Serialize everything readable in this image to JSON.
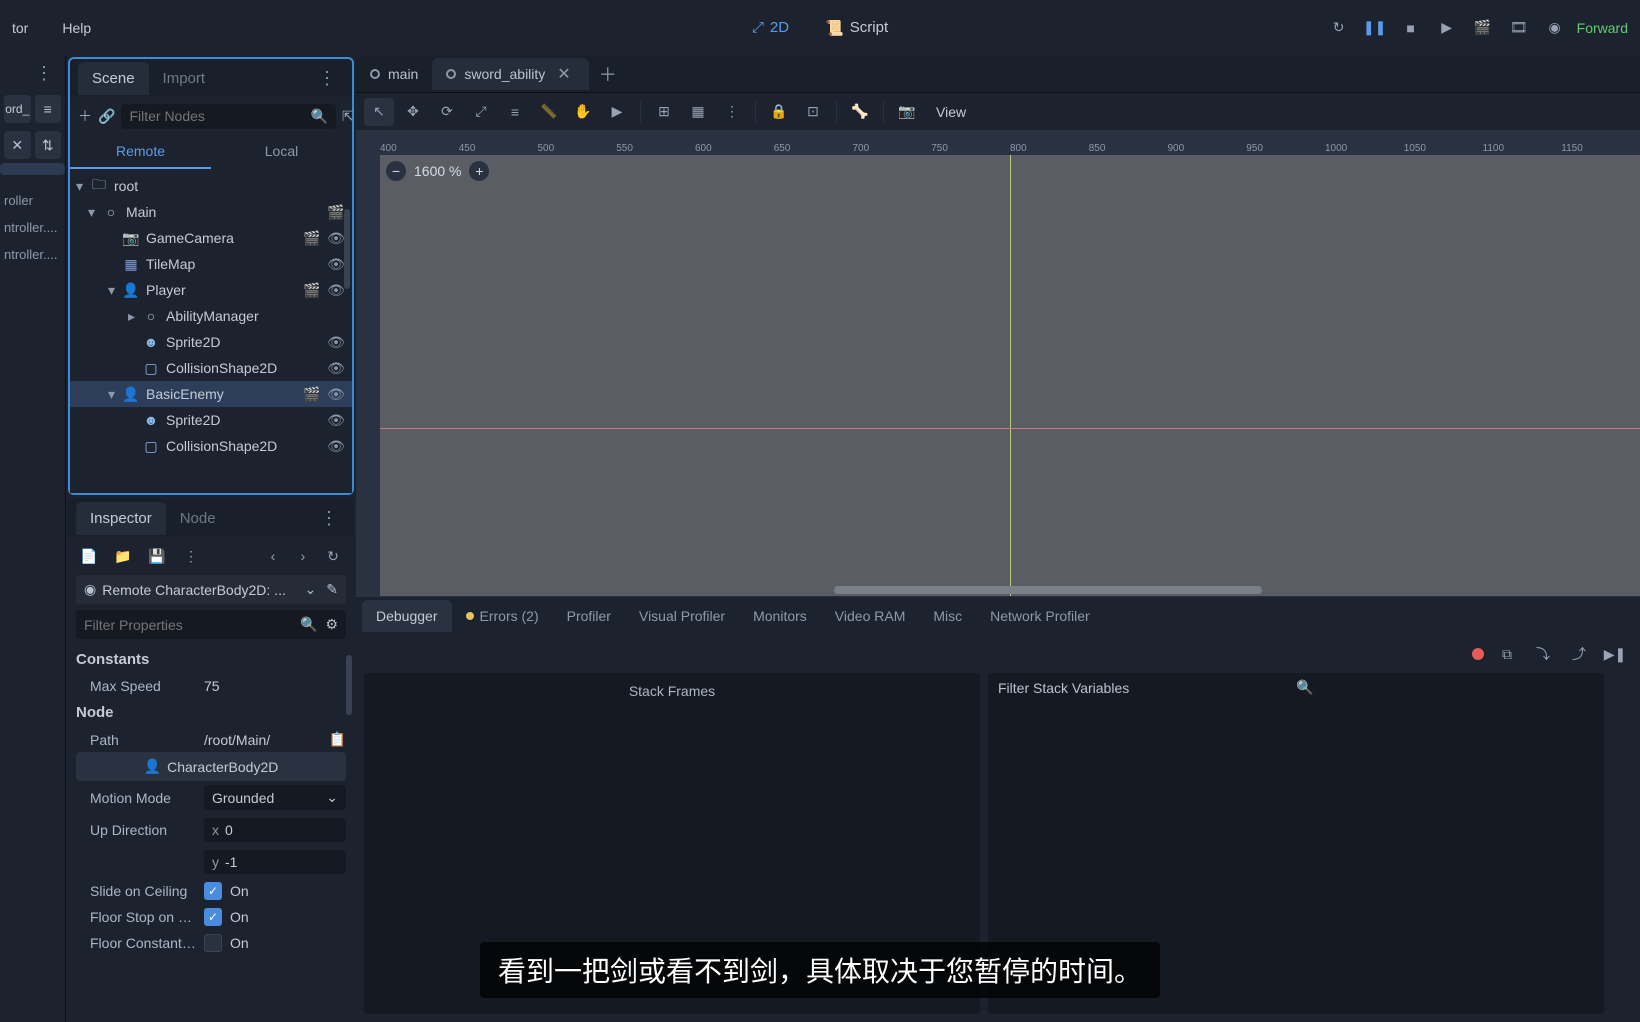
{
  "menu": {
    "items": [
      "tor",
      "Help"
    ]
  },
  "center_modes": {
    "mode2d": "2D",
    "script": "Script"
  },
  "forward": "Forward",
  "far_left": {
    "top_btn": "ord_",
    "items": [
      "",
      "",
      "roller",
      "ntroller....",
      "ntroller...."
    ]
  },
  "scene": {
    "tabs": {
      "scene": "Scene",
      "import": "Import"
    },
    "filter_placeholder": "Filter Nodes",
    "remote": "Remote",
    "local": "Local",
    "tree": [
      {
        "label": "root",
        "indent": 0,
        "icon": "folder",
        "chevron": "▾"
      },
      {
        "label": "Main",
        "indent": 1,
        "icon": "circle",
        "chevron": "▾",
        "right": [
          "clapper"
        ]
      },
      {
        "label": "GameCamera",
        "indent": 2,
        "icon": "camera",
        "right": [
          "clapper",
          "eye"
        ]
      },
      {
        "label": "TileMap",
        "indent": 2,
        "icon": "grid",
        "right": [
          "eye"
        ]
      },
      {
        "label": "Player",
        "indent": 2,
        "icon": "body",
        "chevron": "▾",
        "right": [
          "clapper",
          "eye"
        ]
      },
      {
        "label": "AbilityManager",
        "indent": 3,
        "icon": "circle",
        "chevron": "▸"
      },
      {
        "label": "Sprite2D",
        "indent": 3,
        "icon": "sprite",
        "right": [
          "eye"
        ]
      },
      {
        "label": "CollisionShape2D",
        "indent": 3,
        "icon": "shape",
        "right": [
          "eye"
        ]
      },
      {
        "label": "BasicEnemy",
        "indent": 2,
        "icon": "body",
        "chevron": "▾",
        "selected": true,
        "right": [
          "clapper",
          "eye"
        ]
      },
      {
        "label": "Sprite2D",
        "indent": 3,
        "icon": "sprite",
        "right": [
          "eye"
        ]
      },
      {
        "label": "CollisionShape2D",
        "indent": 3,
        "icon": "shape",
        "right": [
          "eye"
        ]
      }
    ]
  },
  "inspector": {
    "tabs": {
      "inspector": "Inspector",
      "node": "Node"
    },
    "object": "Remote CharacterBody2D: ...",
    "filter_placeholder": "Filter Properties",
    "constants_header": "Constants",
    "max_speed_label": "Max Speed",
    "max_speed_value": "75",
    "node_header": "Node",
    "path_label": "Path",
    "path_value": "/root/Main/",
    "class_btn": "CharacterBody2D",
    "motion_mode_label": "Motion Mode",
    "motion_mode_value": "Grounded",
    "up_dir_label": "Up Direction",
    "up_x_label": "x",
    "up_x_value": "0",
    "up_y_label": "y",
    "up_y_value": "-1",
    "slide_label": "Slide on Ceiling",
    "slide_value": "On",
    "floor_stop_label": "Floor Stop on Sl...",
    "floor_stop_value": "On",
    "floor_const_label": "Floor Constant ...",
    "floor_const_value": "On"
  },
  "viewport": {
    "tabs": [
      {
        "label": "main",
        "active": false
      },
      {
        "label": "sword_ability",
        "active": true
      }
    ],
    "view_btn": "View",
    "zoom": "1600 %"
  },
  "debugger": {
    "tabs": [
      "Debugger",
      "Errors (2)",
      "Profiler",
      "Visual Profiler",
      "Monitors",
      "Video RAM",
      "Misc",
      "Network Profiler"
    ],
    "stack_frames": "Stack Frames",
    "filter_stack": "Filter Stack Variables"
  },
  "subtitle": "看到一把剑或看不到剑，具体取决于您暂停的时间。",
  "ruler_ticks": [
    "400",
    "450",
    "500",
    "550",
    "600",
    "650",
    "700",
    "750",
    "800",
    "850",
    "900",
    "950",
    "1000",
    "1050",
    "1100",
    "1150"
  ]
}
